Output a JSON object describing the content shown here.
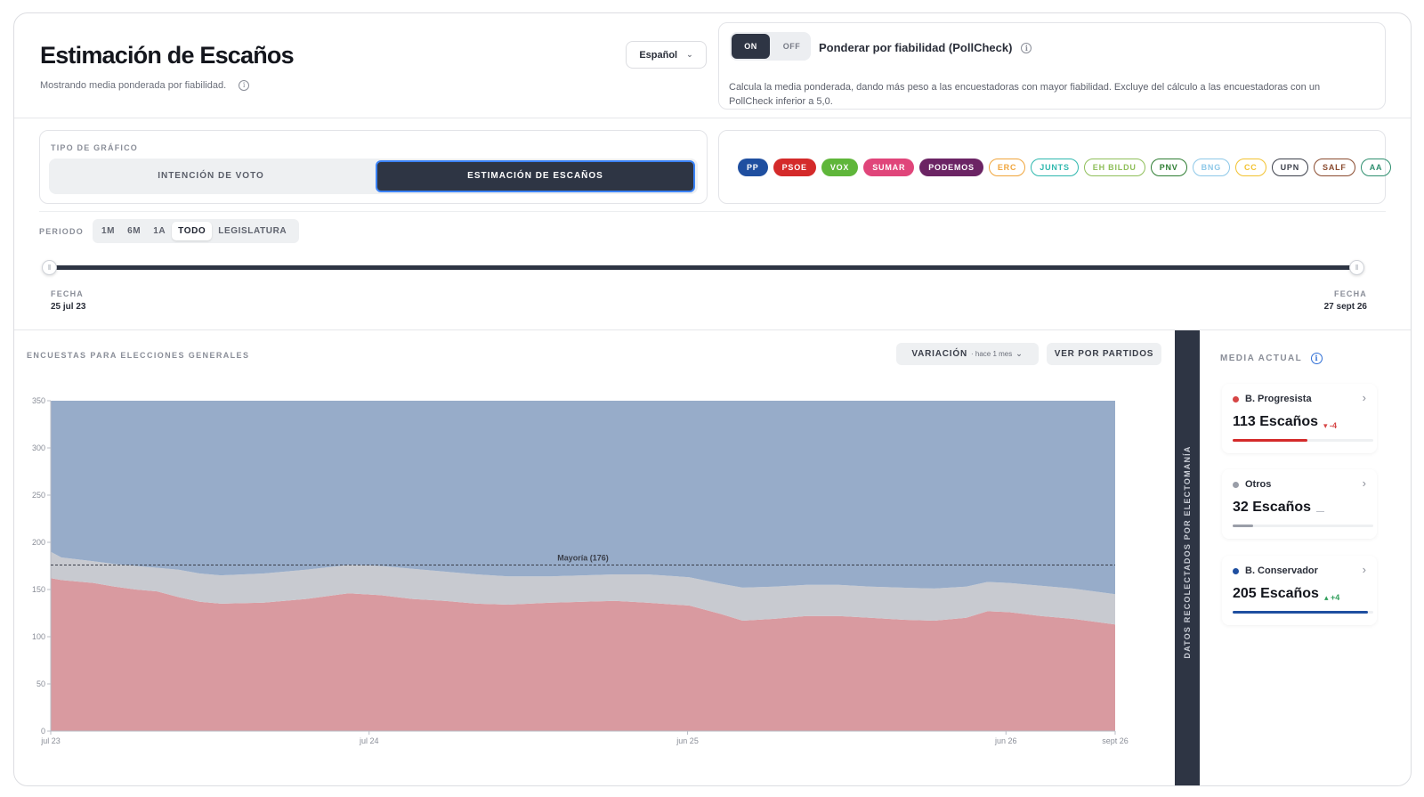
{
  "header": {
    "title": "Estimación de Escaños",
    "subtitle": "Mostrando media ponderada por fiabilidad.",
    "language": "Español"
  },
  "pollcheck": {
    "on_label": "ON",
    "off_label": "OFF",
    "title": "Ponderar por fiabilidad (PollCheck)",
    "description": "Calcula la media ponderada, dando más peso a las encuestadoras con mayor fiabilidad. Excluye del cálculo a las encuestadoras con un PollCheck inferior a 5,0."
  },
  "chart_type": {
    "label": "TIPO DE GRÁFICO",
    "options": [
      "INTENCIÓN DE VOTO",
      "ESTIMACIÓN DE ESCAÑOS"
    ],
    "selected": "ESTIMACIÓN DE ESCAÑOS"
  },
  "parties": [
    {
      "label": "PP",
      "filled": true,
      "color": "#1f4fa0"
    },
    {
      "label": "PSOE",
      "filled": true,
      "color": "#d42a2a"
    },
    {
      "label": "VOX",
      "filled": true,
      "color": "#5fb63a"
    },
    {
      "label": "SUMAR",
      "filled": true,
      "color": "#e0457a"
    },
    {
      "label": "PODEMOS",
      "filled": true,
      "color": "#6b2464"
    },
    {
      "label": "ERC",
      "filled": false,
      "color": "#f0a53c"
    },
    {
      "label": "JUNTS",
      "filled": false,
      "color": "#2fb8ae"
    },
    {
      "label": "EH BILDU",
      "filled": false,
      "color": "#8fbf5a"
    },
    {
      "label": "PNV",
      "filled": false,
      "color": "#2e7d32"
    },
    {
      "label": "BNG",
      "filled": false,
      "color": "#8ec8e8"
    },
    {
      "label": "CC",
      "filled": false,
      "color": "#f2c230"
    },
    {
      "label": "UPN",
      "filled": false,
      "color": "#3b3f4a"
    },
    {
      "label": "SALF",
      "filled": false,
      "color": "#8a4b2f"
    },
    {
      "label": "AA",
      "filled": false,
      "color": "#2f8f6f"
    }
  ],
  "period": {
    "label": "PERIODO",
    "options": [
      "1M",
      "6M",
      "1A",
      "TODO",
      "LEGISLATURA"
    ],
    "selected": "TODO"
  },
  "range": {
    "start_label": "FECHA",
    "start_date": "25 jul 23",
    "end_label": "FECHA",
    "end_date": "27 sept 26"
  },
  "chart_section": {
    "title": "ENCUESTAS PARA ELECCIONES GENERALES",
    "variation_label": "VARIACIÓN",
    "variation_sub": "· hace 1 mes",
    "by_party_button": "VER POR PARTIDOS",
    "side_strip": "DATOS RECOLECTADOS POR ELECTOMANÍA"
  },
  "chart_data": {
    "type": "area",
    "stacked": true,
    "ylim": [
      0,
      350
    ],
    "yticks": [
      0,
      50,
      100,
      150,
      200,
      250,
      300,
      350
    ],
    "xtick_labels": [
      {
        "label": "jul 23",
        "t": 0.0
      },
      {
        "label": "jul 24",
        "t": 0.2991
      },
      {
        "label": "jun 25",
        "t": 0.5983
      },
      {
        "label": "jun 26",
        "t": 0.8974
      },
      {
        "label": "sept 26",
        "t": 1.0
      }
    ],
    "t": [
      0.0,
      0.01,
      0.04,
      0.06,
      0.08,
      0.1,
      0.12,
      0.14,
      0.16,
      0.2,
      0.24,
      0.28,
      0.31,
      0.34,
      0.37,
      0.4,
      0.43,
      0.47,
      0.5,
      0.53,
      0.56,
      0.6,
      0.63,
      0.65,
      0.68,
      0.71,
      0.74,
      0.77,
      0.8,
      0.83,
      0.86,
      0.88,
      0.9,
      0.93,
      0.96,
      1.0
    ],
    "series": [
      {
        "name": "B. Progresista",
        "color": "#d99aa0",
        "values": [
          162,
          160,
          157,
          153,
          150,
          148,
          142,
          137,
          135,
          136,
          140,
          146,
          144,
          140,
          138,
          135,
          134,
          136,
          137,
          138,
          136,
          133,
          124,
          117,
          119,
          122,
          122,
          120,
          118,
          117,
          120,
          127,
          126,
          122,
          119,
          113
        ]
      },
      {
        "name": "Otros",
        "color": "#c8cad0",
        "values": [
          28,
          24,
          23,
          24,
          25,
          25,
          29,
          30,
          30,
          31,
          31,
          30,
          31,
          32,
          31,
          31,
          30,
          28,
          28,
          28,
          30,
          30,
          32,
          35,
          34,
          33,
          33,
          33,
          34,
          34,
          33,
          31,
          31,
          32,
          32,
          32
        ]
      },
      {
        "name": "B. Conservador",
        "color": "#97acc9",
        "values": [
          160,
          166,
          170,
          173,
          175,
          177,
          179,
          183,
          185,
          183,
          179,
          174,
          175,
          178,
          181,
          184,
          186,
          186,
          185,
          184,
          184,
          187,
          194,
          198,
          197,
          195,
          195,
          197,
          198,
          199,
          197,
          192,
          193,
          196,
          199,
          205
        ]
      }
    ],
    "reference_line": {
      "value": 176,
      "label": "Mayoría (176)"
    }
  },
  "media_actual": {
    "title": "MEDIA ACTUAL",
    "blocs": [
      {
        "name": "B. Progresista",
        "seats": "113 Escaños",
        "delta": "▾ -4",
        "delta_color": "#d64545",
        "dot_color": "#d64545",
        "bar_color": "#d42a2a",
        "fraction": 0.529
      },
      {
        "name": "Otros",
        "seats": "32 Escaños",
        "delta": "—",
        "delta_color": "#b6bac3",
        "dot_color": "#9a9ea8",
        "bar_color": "#9a9ea8",
        "fraction": 0.148
      },
      {
        "name": "B. Conservador",
        "seats": "205 Escaños",
        "delta": "▴ +4",
        "delta_color": "#2f9e5a",
        "dot_color": "#1f4fa0",
        "bar_color": "#1f4fa0",
        "fraction": 0.96
      }
    ]
  }
}
